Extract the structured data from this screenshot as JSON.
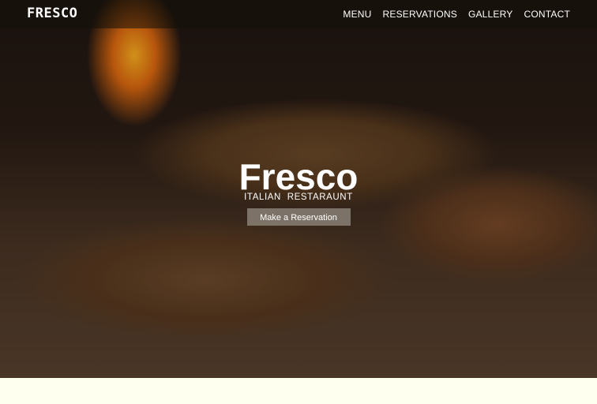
{
  "brand": {
    "logo_text": "FRESCO"
  },
  "nav": {
    "items": [
      {
        "label": "MENU"
      },
      {
        "label": "RESERVATIONS"
      },
      {
        "label": "GALLERY"
      },
      {
        "label": "CONTACT"
      }
    ]
  },
  "hero": {
    "title": "Fresco",
    "subtitle": "ITALIAN RESTARAUNT",
    "cta_label": "Make a Reservation"
  },
  "colors": {
    "page_background": "#fffff0",
    "navbar_background": "#14100a",
    "text": "#ffffff"
  }
}
